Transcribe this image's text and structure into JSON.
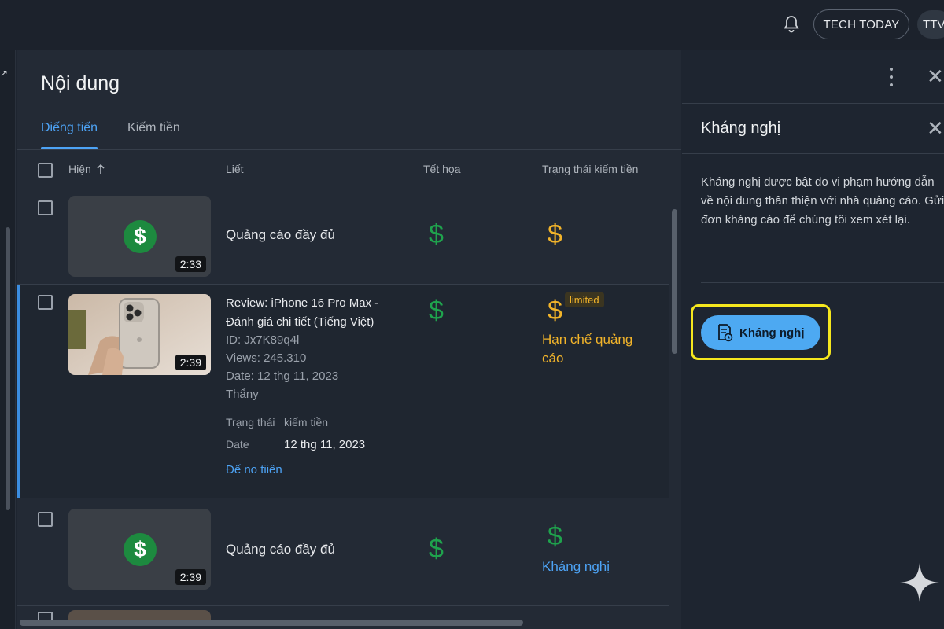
{
  "topbar": {
    "channel_label": "TECH TODAY",
    "avatar_label": "TTV"
  },
  "page": {
    "title": "Nội dung"
  },
  "tabs": [
    {
      "label": "Diếng tiến"
    },
    {
      "label": "Kiếm tiền"
    }
  ],
  "table": {
    "headers": {
      "col1": "Hiện",
      "col2": "Liết",
      "col3": "Tết họa",
      "col4": "Trạng thái kiếm tiền"
    },
    "rows": [
      {
        "title": "Quảng cáo đầy đủ",
        "duration": "2:33"
      },
      {
        "title": "Review: iPhone 16 Pro Max - Đánh giá chi tiết (Tiếng Việt)",
        "duration": "2:39",
        "id": "ID: Jx7K89q4l",
        "views": "Views: 245.310",
        "date": "Date: 12 thg 11, 2023",
        "extra": "Thẩny",
        "status_label_a": "Trạng thái",
        "status_label_b": "kiếm tiền",
        "date_label": "Date",
        "date_value": "12 thg 11, 2023",
        "link": "Đế no tiiên",
        "badge": "limited",
        "status_text": "Hạn chế quảng cáo"
      },
      {
        "title": "Quảng cáo đầy đủ",
        "duration": "2:39",
        "status_link": "Kháng nghị"
      }
    ]
  },
  "panel": {
    "title": "Kháng nghị",
    "description": "Kháng nghị được bật do vi phạm hướng dẫn về nội dung thân thiện với nhà quảng cáo. Gửi đơn kháng cáo để chúng tôi xem xét lại.",
    "button_label": "Kháng nghị"
  },
  "colors": {
    "accent": "#4da3f5",
    "green": "#1fa34d",
    "yellow": "#f2b42a",
    "highlight": "#f5e71e"
  }
}
